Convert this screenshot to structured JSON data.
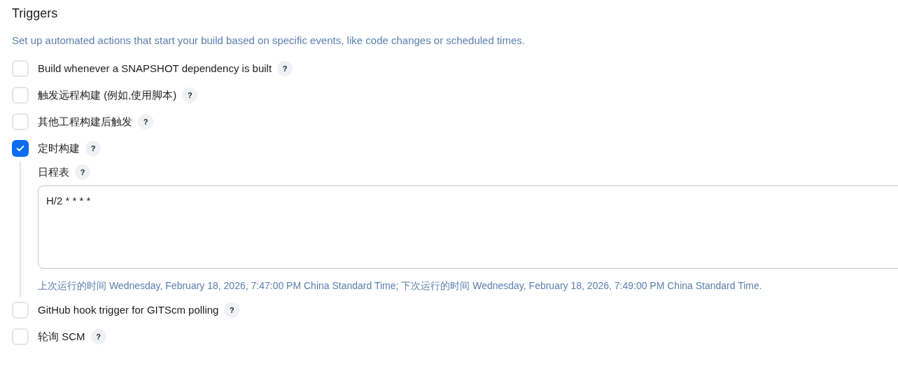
{
  "section": {
    "title": "Triggers",
    "description": "Set up automated actions that start your build based on specific events, like code changes or scheduled times."
  },
  "triggers": [
    {
      "label": "Build whenever a SNAPSHOT dependency is built",
      "help": "?",
      "checked": false
    },
    {
      "label": "触发远程构建 (例如,使用脚本)",
      "help": "?",
      "checked": false
    },
    {
      "label": "其他工程构建后触发",
      "help": "?",
      "checked": false
    },
    {
      "label": "定时构建",
      "help": "?",
      "checked": true,
      "schedule": {
        "label": "日程表",
        "help": "?",
        "value": "H/2 * * * *",
        "hint": "上次运行的时间 Wednesday, February 18, 2026, 7:47:00 PM China Standard Time; 下次运行的时间 Wednesday, February 18, 2026, 7:49:00 PM China Standard Time."
      }
    },
    {
      "label": "GitHub hook trigger for GITScm polling",
      "help": "?",
      "checked": false
    },
    {
      "label": "轮询 SCM",
      "help": "?",
      "checked": false
    }
  ]
}
